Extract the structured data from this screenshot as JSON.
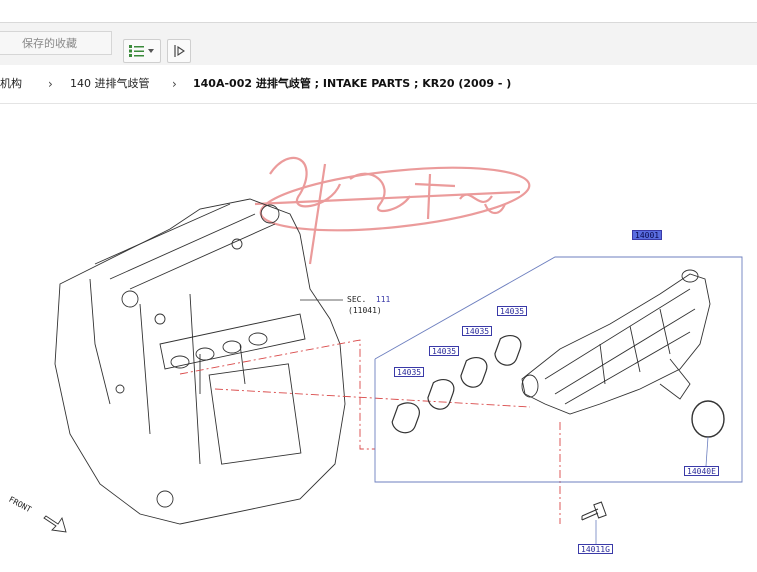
{
  "toolbar": {
    "saved_search_placeholder": "保存的收藏"
  },
  "breadcrumb": {
    "item_1": "机构",
    "item_2": "140 进排气歧管",
    "current": "140A-002 进排气歧管 ; INTAKE PARTS ; KR20 (2009 - )"
  },
  "diagram": {
    "watermark": "鄂龙汽配",
    "sec_label": "SEC.",
    "sec_number": "111",
    "sec_sub": "(11041)",
    "front_label": "FRONT",
    "callouts": {
      "manifold": "14001",
      "gasket_1": "14035",
      "gasket_2": "14035",
      "gasket_3": "14035",
      "gasket_4": "14035",
      "oring": "14040E",
      "bolt": "14011G"
    }
  },
  "colors": {
    "toolbar_bg": "#f3f3f3",
    "callout_blue": "#3a3aa8",
    "callout_highlight": "#5a6de0",
    "watermark_red": "#e88a8a",
    "leader_red": "#d94848",
    "view_icon_green": "#3a8a3a"
  }
}
